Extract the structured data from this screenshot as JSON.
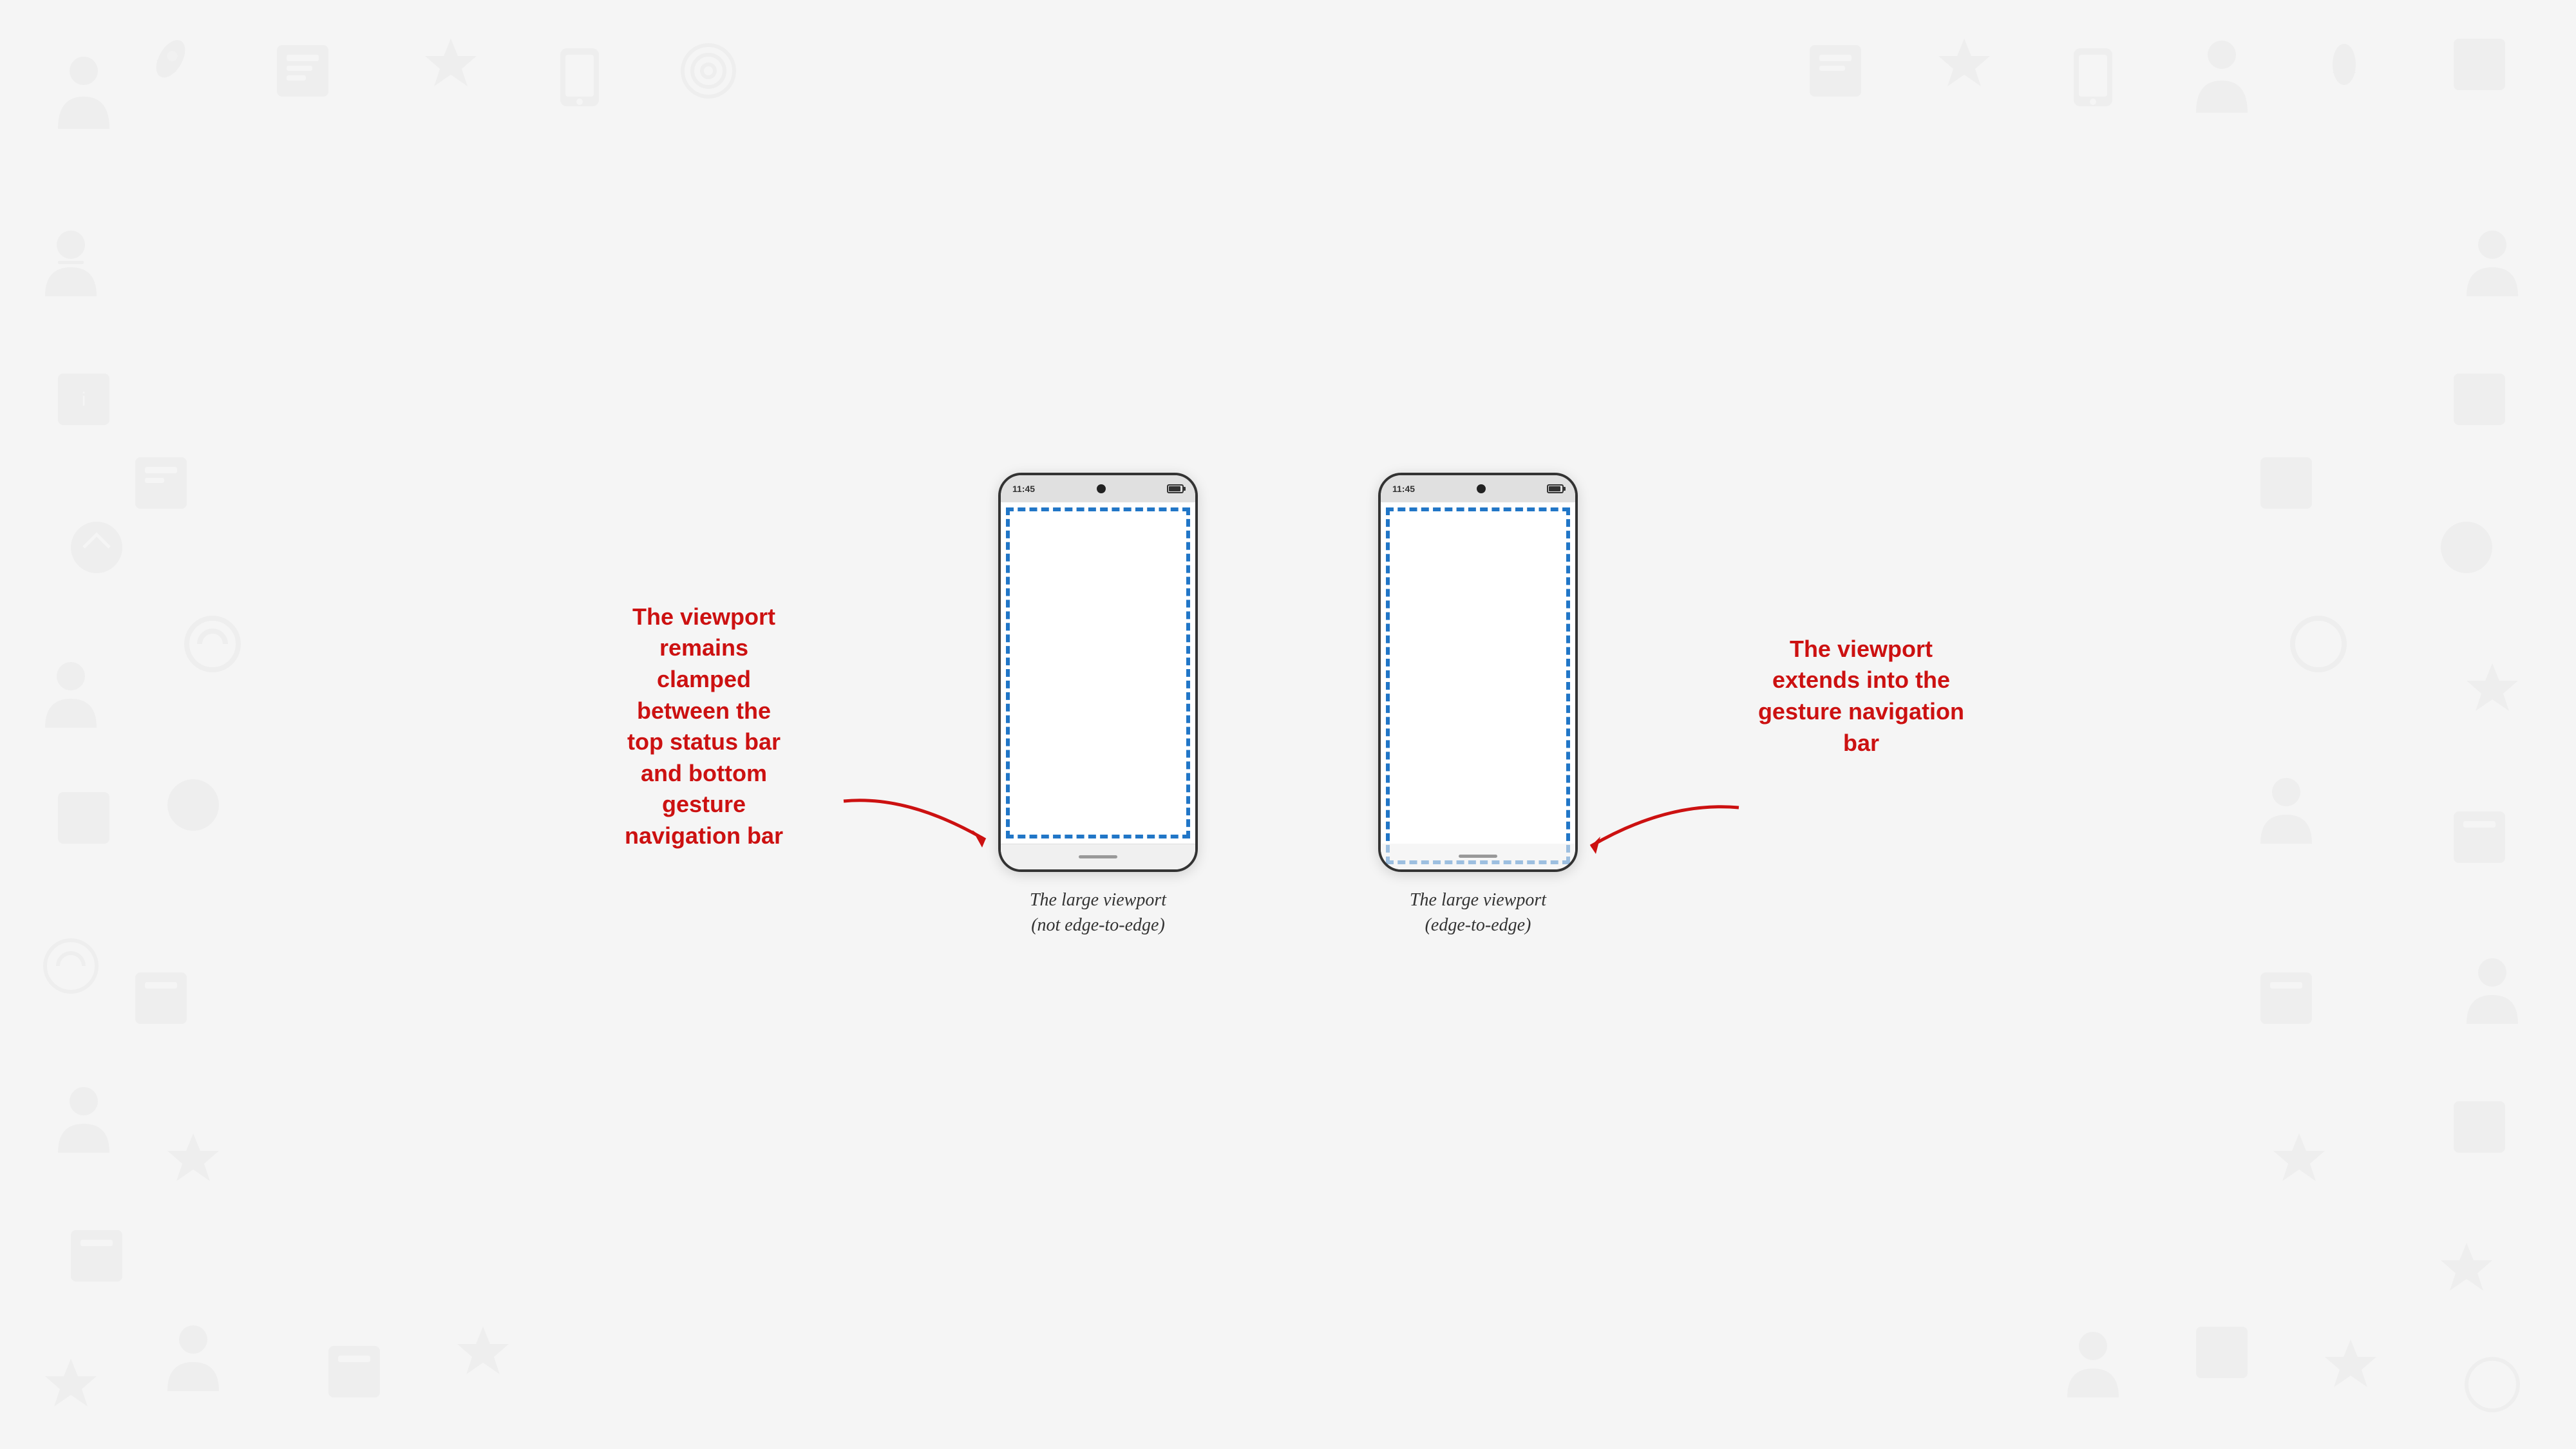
{
  "background": {
    "color": "#f5f5f5"
  },
  "phones": [
    {
      "id": "not-edge-to-edge",
      "status_time": "11:45",
      "caption_line1": "The large viewport",
      "caption_line2": "(not edge-to-edge)",
      "viewport_type": "clamped",
      "annotation": "The viewport\nremains\nclamped\nbetween the\ntop status bar\nand bottom\ngesture\nnavigation bar",
      "annotation_side": "left"
    },
    {
      "id": "edge-to-edge",
      "status_time": "11:45",
      "caption_line1": "The large viewport",
      "caption_line2": "(edge-to-edge)",
      "viewport_type": "extended",
      "annotation": "The viewport\nextends into the\ngesture navigation\nbar",
      "annotation_side": "right"
    }
  ],
  "colors": {
    "accent_red": "#cc1111",
    "phone_border": "#333333",
    "viewport_dashed": "#2176c7",
    "status_bar_bg": "#e0e0e0"
  }
}
